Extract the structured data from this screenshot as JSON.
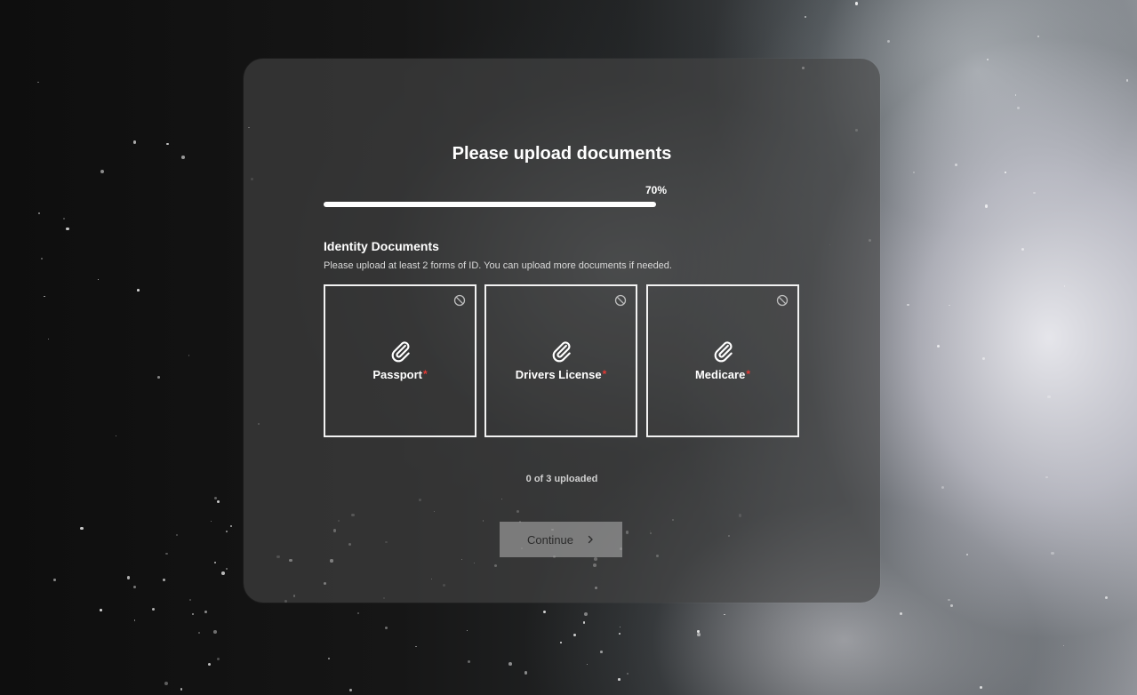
{
  "page": {
    "title": "Please upload documents",
    "progress": {
      "percent_label": "70%",
      "value": 0.7
    }
  },
  "section": {
    "title": "Identity Documents",
    "description": "Please upload at least 2 forms of ID. You can upload more documents if needed."
  },
  "documents": [
    {
      "label": "Passport",
      "required_marker": "*",
      "icon": "paperclip-icon",
      "status_icon": "blocked-icon"
    },
    {
      "label": "Drivers License",
      "required_marker": "*",
      "icon": "paperclip-icon",
      "status_icon": "blocked-icon"
    },
    {
      "label": "Medicare",
      "required_marker": "*",
      "icon": "paperclip-icon",
      "status_icon": "blocked-icon"
    }
  ],
  "upload_count": "0 of 3 uploaded",
  "continue_button": {
    "label": "Continue",
    "icon": "chevron-right-icon"
  },
  "colors": {
    "required": "#e53935",
    "card_bg": "#464646",
    "text": "#ffffff"
  }
}
